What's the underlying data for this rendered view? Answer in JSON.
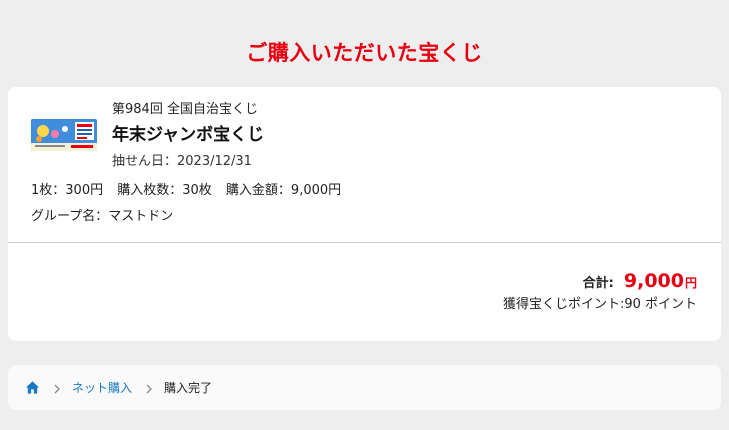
{
  "page": {
    "title": "ご購入いただいた宝くじ"
  },
  "ticket": {
    "number": "第984回 全国自治宝くじ",
    "name": "年末ジャンボ宝くじ",
    "draw_date": "抽せん日：2023/12/31",
    "unit_price": "1枚：300円",
    "quantity": "購入枚数：30枚",
    "amount": "購入金額：9,000円",
    "group": "グループ名：マストドン",
    "thumbnail_icon": "lottery-ticket-image"
  },
  "summary": {
    "total_label": "合計:",
    "total_amount": "9,000",
    "total_unit": "円",
    "points": "獲得宝くじポイント:90 ポイント"
  },
  "breadcrumb": {
    "home_icon": "home-icon",
    "items": [
      {
        "label": "ネット購入"
      },
      {
        "label": "購入完了"
      }
    ]
  },
  "colors": {
    "accent": "#e60012",
    "link": "#1a78c2",
    "background": "#eeeeee"
  }
}
